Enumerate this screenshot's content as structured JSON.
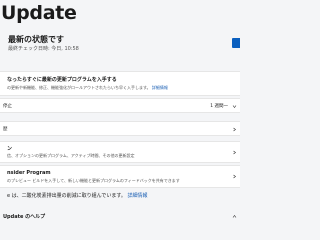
{
  "page": {
    "title": "Update"
  },
  "status": {
    "title": "最新の状態です",
    "last_checked": "最終チェック日時: 今日, 10:58"
  },
  "promo": {
    "title": "なったらすぐに最新の更新プログラムを入手する",
    "desc": "の更新や新機能、修正、機能強化がロールアウトされたらいち早く入手します。",
    "link": "詳細情報"
  },
  "pause": {
    "label": "停止",
    "value": "1 週間一"
  },
  "history": {
    "label": "歴"
  },
  "advanced": {
    "title": "ン",
    "desc": "信、オプションの更新プログラム、アクティブ時間、その他の更新設定"
  },
  "insider": {
    "title": "nsider Program",
    "desc": "のプレビュー ビルドを入手して、新しい機能と更新プログラムのフィードバックを共有できます"
  },
  "footer": {
    "text": "e は、二酸化炭素排出量の削減に取り組んでいます。",
    "link": "詳細情報"
  },
  "help": {
    "label": "Update のヘルプ"
  },
  "colors": {
    "accent": "#0a5fbf",
    "link": "#1a5fb4"
  }
}
